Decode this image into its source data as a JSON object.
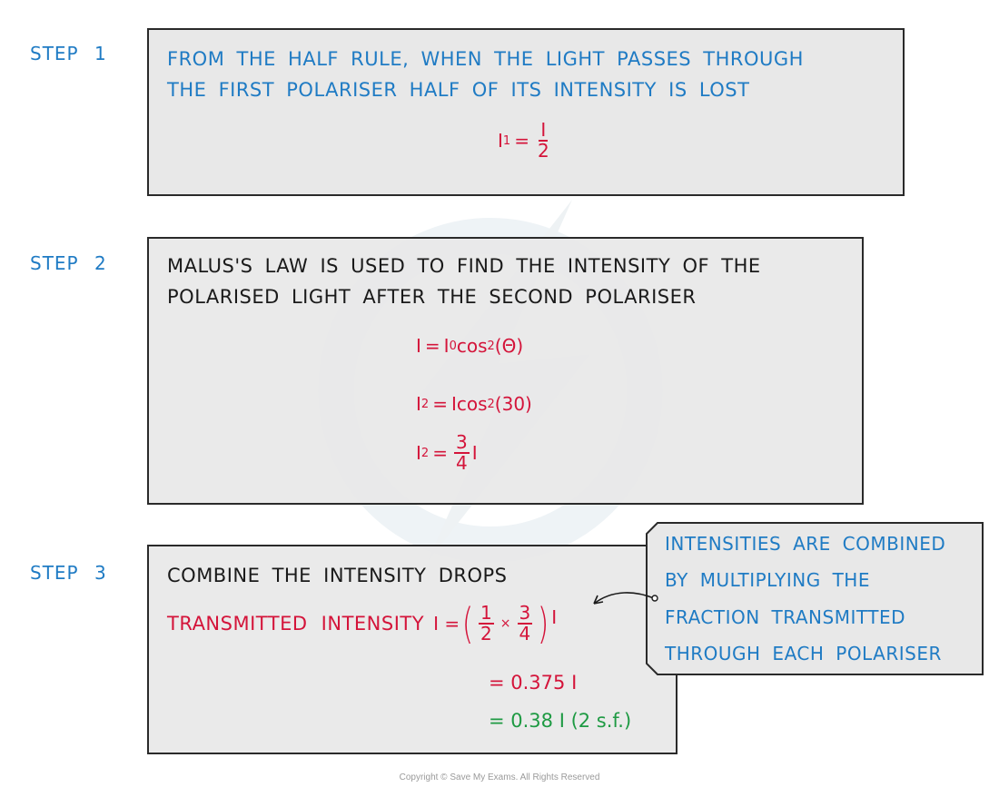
{
  "steps": [
    {
      "label": "STEP 1",
      "lines": [
        "FROM THE HALF RULE, WHEN THE LIGHT PASSES THROUGH",
        "THE FIRST POLARISER HALF OF ITS INTENSITY IS LOST"
      ],
      "equation": {
        "lhs": "I",
        "lhs_sub": "1",
        "eq": "=",
        "num": "I",
        "den": "2"
      }
    },
    {
      "label": "STEP 2",
      "lines": [
        "MALUS'S LAW IS USED TO FIND THE INTENSITY OF THE",
        "POLARISED LIGHT AFTER THE SECOND POLARISER"
      ],
      "equations": [
        {
          "lhs": "I",
          "eq": "=",
          "rhs_a": "I",
          "rhs_sub": "0",
          "rhs_b": "cos",
          "sup": "2",
          "rhs_c": "(Θ)"
        },
        {
          "lhs": "I",
          "lhs_sub": "2",
          "eq": "=",
          "rhs_a": "Icos",
          "sup": "2",
          "rhs_c": "(30)"
        },
        {
          "lhs": "I",
          "lhs_sub": "2",
          "eq": "=",
          "num": "3",
          "den": "4",
          "tail": "I"
        }
      ]
    },
    {
      "label": "STEP 3",
      "lines": [
        "COMBINE THE INTENSITY DROPS"
      ],
      "transmitted": {
        "label": "TRANSMITTED INTENSITY",
        "lhs": "I =",
        "f1_num": "1",
        "f1_den": "2",
        "times": "×",
        "f2_num": "3",
        "f2_den": "4",
        "tail": "I"
      },
      "result_exact": "= 0.375 I",
      "result_rounded": "= 0.38 I (2 s.f.)"
    }
  ],
  "callout": {
    "lines": [
      "INTENSITIES ARE COMBINED",
      "BY MULTIPLYING THE",
      "FRACTION TRANSMITTED",
      "THROUGH EACH POLARISER"
    ]
  },
  "copyright": "Copyright © Save My Exams. All Rights Reserved",
  "colors": {
    "blue": "#1f7bc4",
    "red": "#d4143a",
    "green": "#1e9a43",
    "box_fill": "#e8e8e8"
  }
}
